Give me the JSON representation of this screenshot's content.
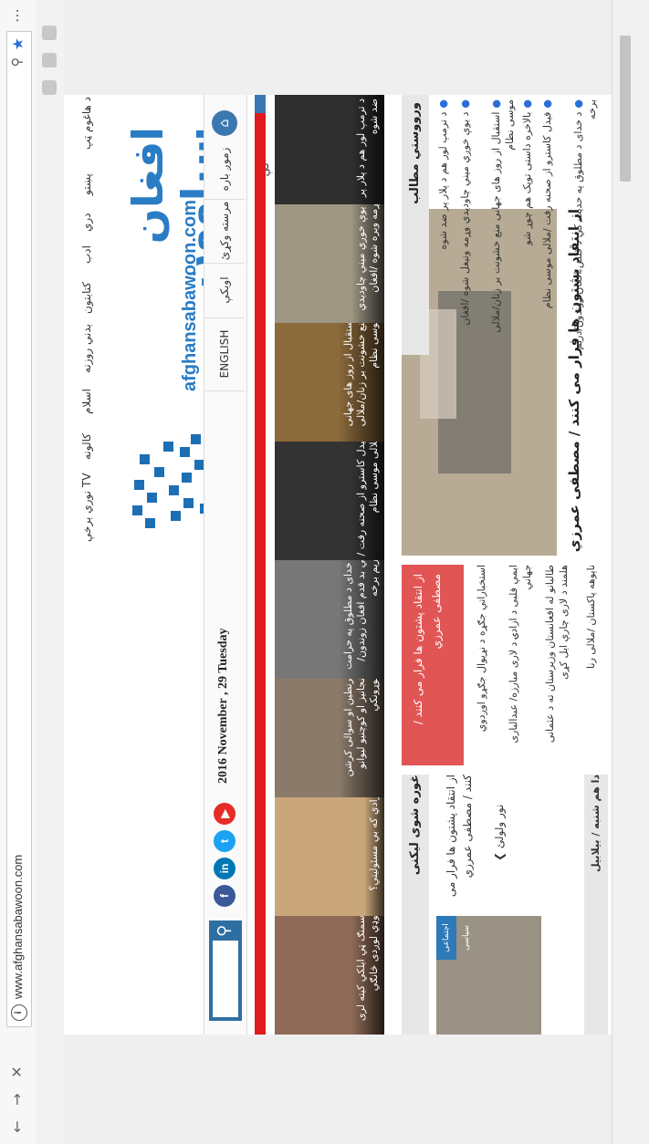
{
  "browser": {
    "url": "www.afghansabawoon.com",
    "back_icon": "←",
    "forward_icon": "→",
    "close_icon": "✕",
    "info_icon": "i",
    "zoom_icon": "⚲",
    "star_icon": "★",
    "menu_icon": "⋯"
  },
  "site": {
    "nav": [
      "د هاغوم ټپ",
      "پښتو",
      "دري",
      "ادب",
      "کتابتون",
      "بدني روزنه",
      "اسلام",
      "کالونه",
      "TV",
      "نوري برخې"
    ],
    "logo_text": "افغان سباوون",
    "logo_sub": "afghansabawoon.com",
    "date": "2016 November , 29 Tuesday",
    "tabs": [
      "ENGLISH",
      "اوبکې",
      "مرسته وکړئ",
      "زموږ باره کې"
    ],
    "social": [
      "f",
      "in",
      "t",
      "▶"
    ],
    "thumbs": [
      {
        "caption": "وسمنګ ټي ایلکي کیته لری ګوډي لوږدی څانګي"
      },
      {
        "caption": "ازادي که بي مسئولیتي؟"
      },
      {
        "caption": "قرنطین او سوالی کرشن ګنجانیز او کوچنیو لیوانو جوړونکي"
      },
      {
        "caption": "د خدای د مطلوق په حرامت کي بد قدم افغان زوندون/دریم برخه"
      },
      {
        "caption": "فیدل کاسترو از صحنه رفت /ملالی موسی نظام"
      },
      {
        "caption": "استقبال از روز های جهانی منع خشونت بر زنان/ملالی موسی نظام"
      },
      {
        "caption": "د یوې خوږي ميني چاوديدي وړمه ویره شوه /افغان"
      },
      {
        "caption": "د ترمپ لور هم د پلار پر ضد شوه"
      }
    ],
    "left": {
      "heading": "غوره شوی لیکنی",
      "badge": "اجتماعی سیاسی",
      "title": "از انتقاد پشتون ها فرار می کنند / مصطفی عمرزي",
      "more": "نور ولولئ ❯",
      "date": "دا هم شنبه / بیلابیل"
    },
    "middle": {
      "red_title": "از انتقاد پشتون ها فرار می کنند /مصطفی عمرزي",
      "lines": [
        "استخباراتي جګړه د نړیوال جګړو اوږدوي",
        "ایمې قلبی د ازادۍ د لاری مبارزه/ عبدالباری جهاني",
        "طالبانو له افغانستان وزیرستان ته د عثمانی هلمند د لاری چارې ایل کړی",
        "ناپوهه پاکستان /ملالی رنا"
      ],
      "big_caption": "از انتقاد پشتون ها فرار می کنند / مصطفی عمرزي"
    },
    "right": {
      "heading": "ورووستي مطالب",
      "items": [
        "د ترمپ لور هم د پلار پر ضد شوه",
        "د يوې خوږي ميني چاوديدي وړمه وتيغل شوه /افغان",
        "استقبال از روز های جهانی منع خشونت بر زنان/ملالی موسی نظام",
        "بالاخره داستی توپک هم چوړ شو",
        "فیدل کاسترو از صحنه رفت /ملالی موسی نظام",
        "د خدای د مطلوق په حدیث کي د قبض افغان ژوندون/دریم برخه"
      ]
    }
  },
  "colors": {
    "accent": "#2a7cc4",
    "red_strip": "#e01b1b",
    "red_box": "#e25555",
    "search_bg": "#2e6fa3"
  }
}
